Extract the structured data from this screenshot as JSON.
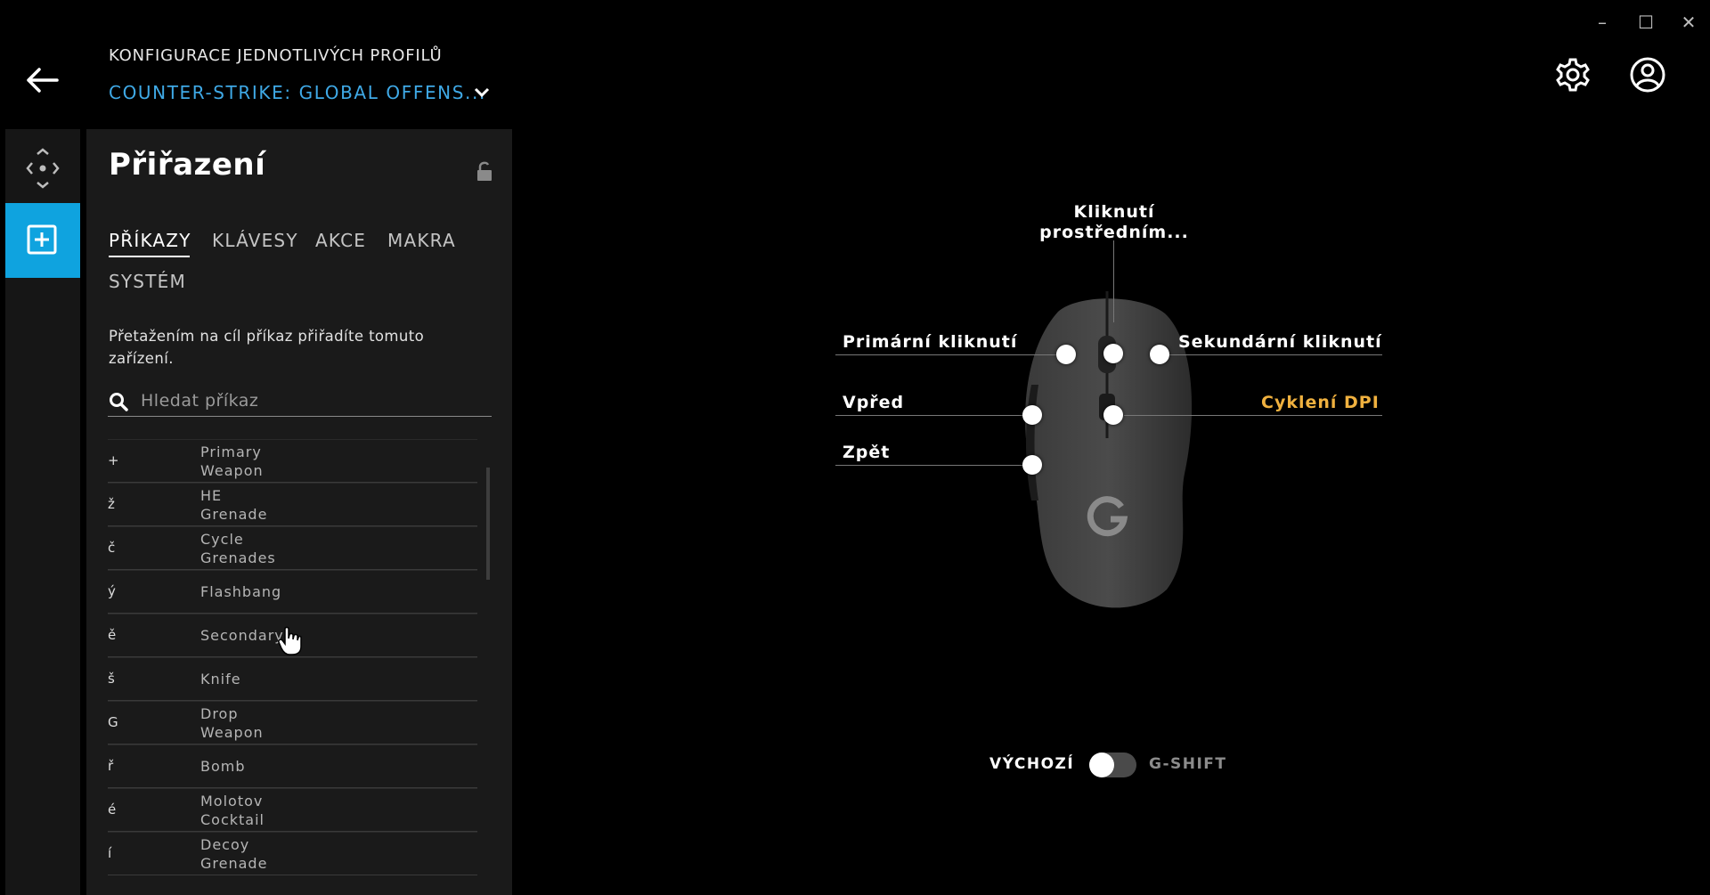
{
  "window": {
    "minimize": "–",
    "maximize": "☐",
    "close": "✕"
  },
  "header": {
    "subtitle": "KONFIGURACE JEDNOTLIVÝCH PROFILŮ",
    "profile": "COUNTER-STRIKE: GLOBAL OFFENS..."
  },
  "panel": {
    "title": "Přiřazení",
    "tabs": [
      "PŘÍKAZY",
      "KLÁVESY",
      "AKCE",
      "MAKRA",
      "SYSTÉM"
    ],
    "hint": "Přetažením na cíl příkaz přiřadíte tomuto zařízení.",
    "search_placeholder": "Hledat příkaz",
    "commands": [
      {
        "key": "+",
        "line1": "Primary",
        "line2": "Weapon"
      },
      {
        "key": "ž",
        "line1": "HE",
        "line2": "Grenade"
      },
      {
        "key": "č",
        "line1": "Cycle",
        "line2": "Grenades"
      },
      {
        "key": "ý",
        "line1": "Flashbang",
        "line2": ""
      },
      {
        "key": "ě",
        "line1": "Secondary",
        "line2": ""
      },
      {
        "key": "š",
        "line1": "Knife",
        "line2": ""
      },
      {
        "key": "G",
        "line1": "Drop",
        "line2": "Weapon"
      },
      {
        "key": "ř",
        "line1": "Bomb",
        "line2": ""
      },
      {
        "key": "é",
        "line1": "Molotov",
        "line2": "Cocktail"
      },
      {
        "key": "í",
        "line1": "Decoy",
        "line2": "Grenade"
      }
    ]
  },
  "mouse": {
    "middle_l1": "Kliknutí",
    "middle_l2": "prostředním...",
    "primary": "Primární kliknutí",
    "secondary": "Sekundární kliknutí",
    "forward": "Vpřed",
    "dpi": "Cyklení DPI",
    "back": "Zpět"
  },
  "toggle": {
    "left": "VÝCHOZÍ",
    "right": "G-SHIFT"
  },
  "colors": {
    "accent": "#0fa3df",
    "profile": "#3fa9e6",
    "dpi": "#f0b13f"
  }
}
